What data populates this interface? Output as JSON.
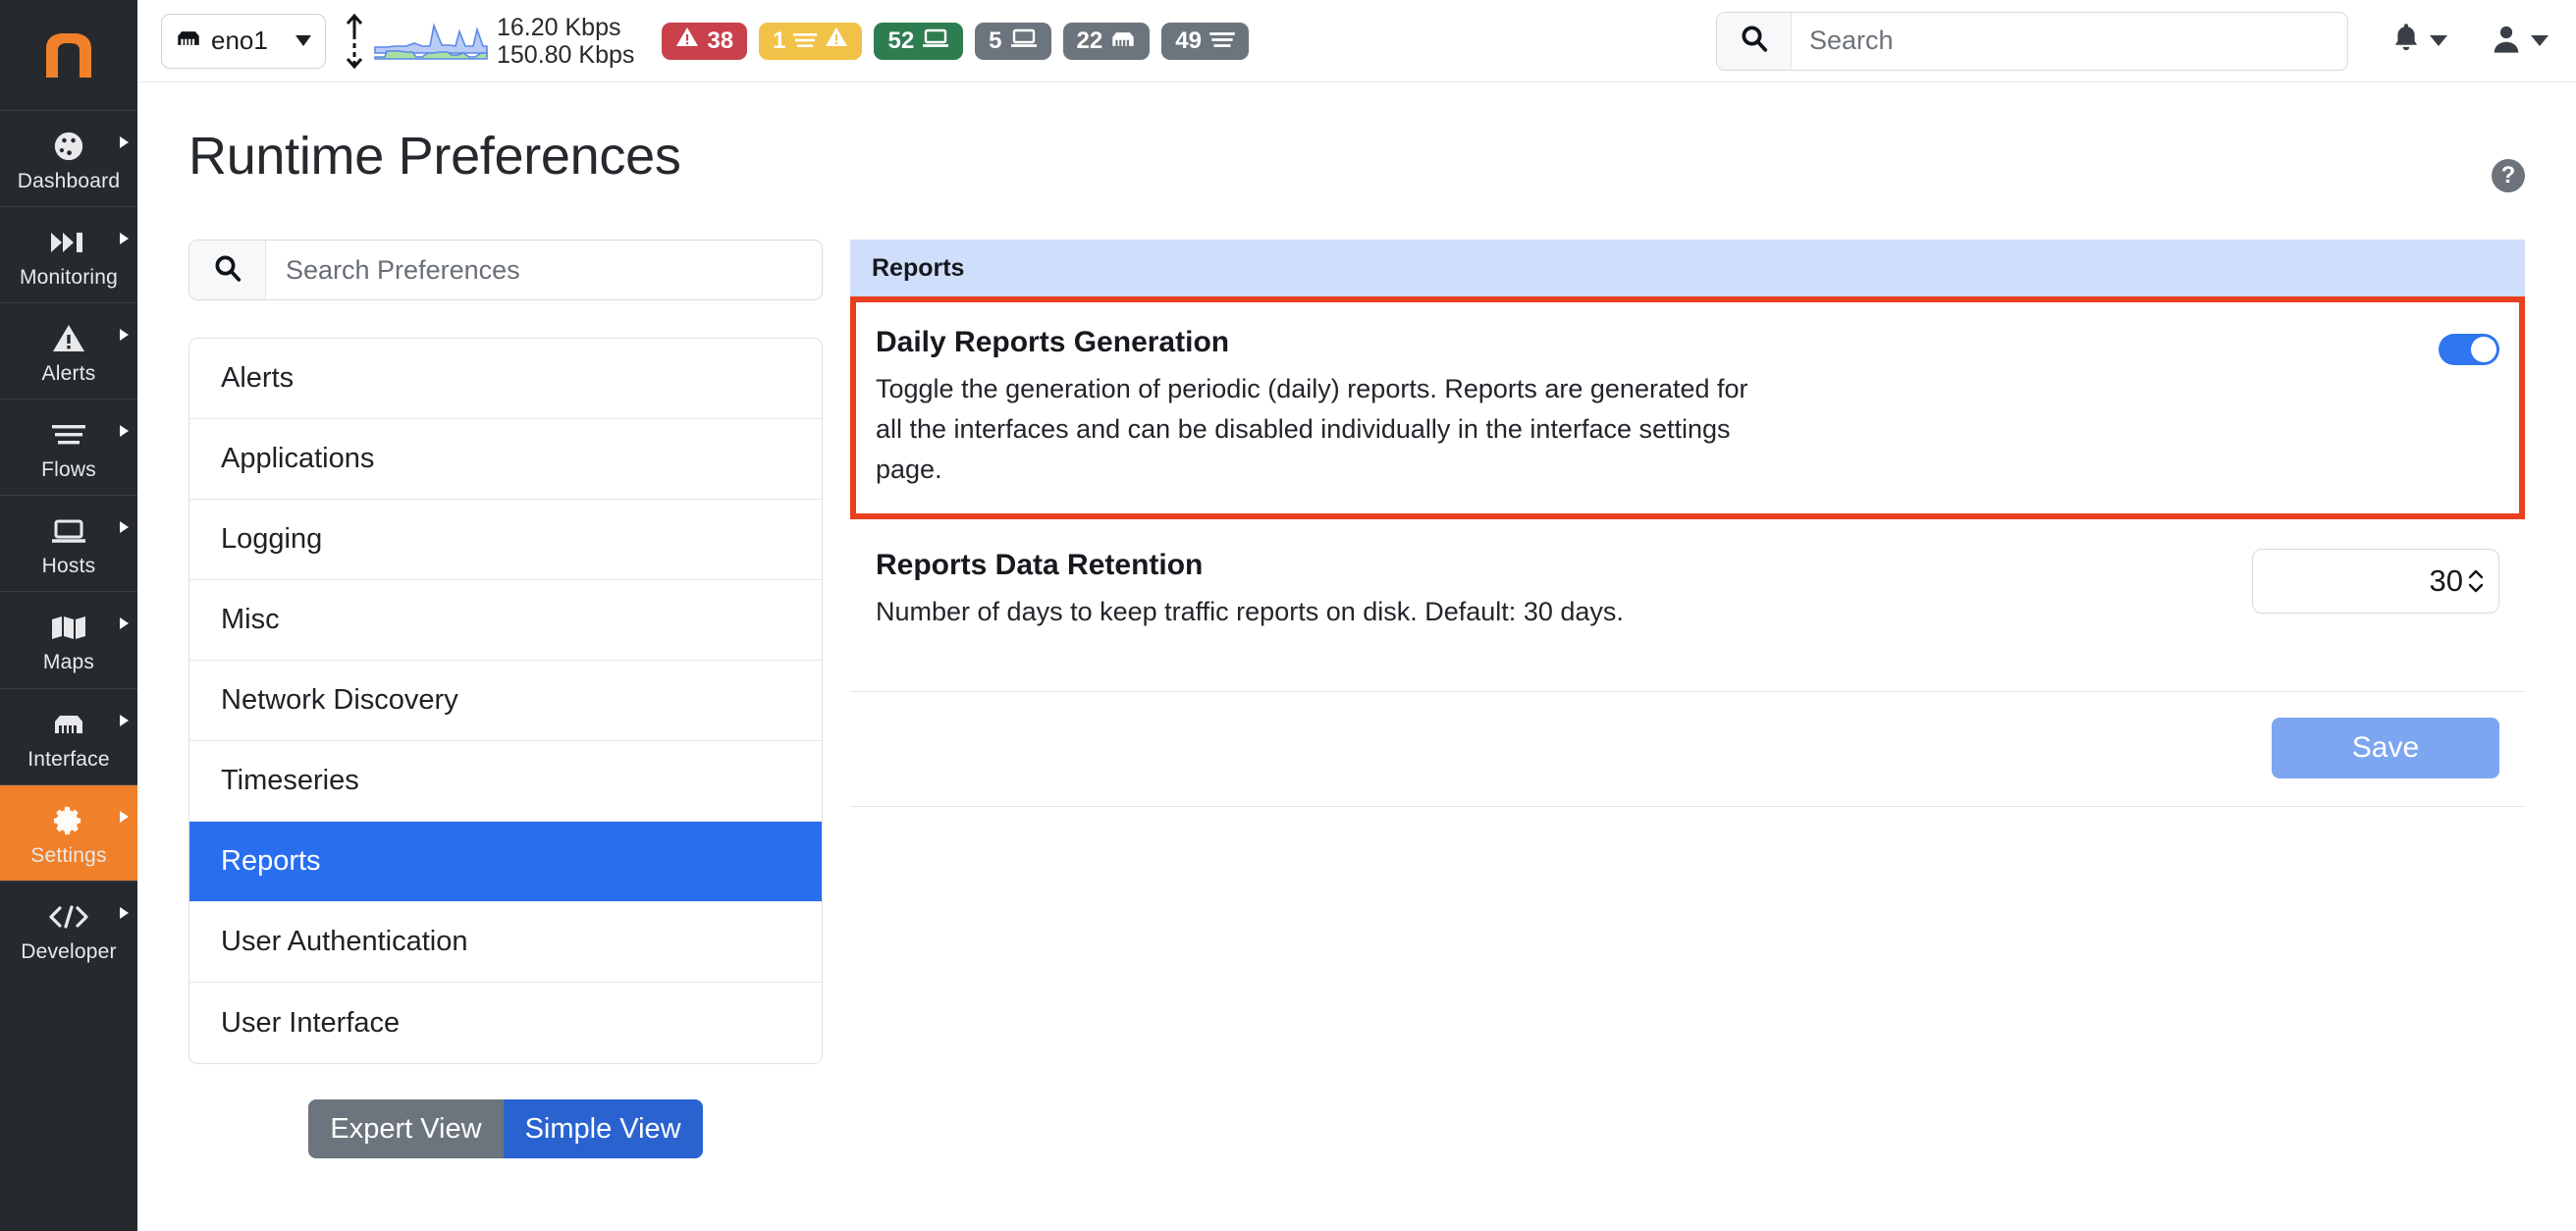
{
  "sidebar": {
    "logo_name": "ntopng-logo",
    "items": [
      {
        "label": "Dashboard",
        "icon": "dashboard-icon",
        "active": false
      },
      {
        "label": "Monitoring",
        "icon": "monitoring-icon",
        "active": false
      },
      {
        "label": "Alerts",
        "icon": "alerts-warning-icon",
        "active": false
      },
      {
        "label": "Flows",
        "icon": "flows-lines-icon",
        "active": false
      },
      {
        "label": "Hosts",
        "icon": "hosts-laptop-icon",
        "active": false
      },
      {
        "label": "Maps",
        "icon": "maps-icon",
        "active": false
      },
      {
        "label": "Interface",
        "icon": "interface-ethernet-icon",
        "active": false
      },
      {
        "label": "Settings",
        "icon": "settings-gear-icon",
        "active": true
      },
      {
        "label": "Developer",
        "icon": "developer-code-icon",
        "active": false
      }
    ]
  },
  "topbar": {
    "interface": {
      "name": "eno1",
      "icon": "ethernet-port-icon"
    },
    "traffic": {
      "up_rate": "16.20 Kbps",
      "down_rate": "150.80 Kbps",
      "sparkline_name": "traffic-sparkline"
    },
    "badges": [
      {
        "value": "38",
        "icon": "warning-triangle-icon",
        "color": "#c9414b",
        "name": "badge-alerts-critical"
      },
      {
        "value": "1",
        "icon": "flow-warning-icon",
        "color": "#f1c248",
        "name": "badge-flow-alerts"
      },
      {
        "value": "52",
        "icon": "laptop-icon",
        "color": "#2e7d51",
        "name": "badge-hosts-active"
      },
      {
        "value": "5",
        "icon": "laptop-icon",
        "color": "#6c757d",
        "name": "badge-hosts-idle"
      },
      {
        "value": "22",
        "icon": "ethernet-port-icon",
        "color": "#6c757d",
        "name": "badge-devices"
      },
      {
        "value": "49",
        "icon": "flows-lines-icon",
        "color": "#6c757d",
        "name": "badge-flows"
      }
    ],
    "search": {
      "placeholder": "Search",
      "value": "",
      "icon": "search-icon"
    },
    "notifications_icon": "bell-icon",
    "user_icon": "user-avatar-icon"
  },
  "page": {
    "title": "Runtime Preferences",
    "help_label": "?"
  },
  "preferences": {
    "search": {
      "placeholder": "Search Preferences",
      "value": "",
      "icon": "search-icon"
    },
    "categories": [
      {
        "label": "Alerts",
        "active": false
      },
      {
        "label": "Applications",
        "active": false
      },
      {
        "label": "Logging",
        "active": false
      },
      {
        "label": "Misc",
        "active": false
      },
      {
        "label": "Network Discovery",
        "active": false
      },
      {
        "label": "Timeseries",
        "active": false
      },
      {
        "label": "Reports",
        "active": true
      },
      {
        "label": "User Authentication",
        "active": false
      },
      {
        "label": "User Interface",
        "active": false
      }
    ],
    "view_toggle": {
      "expert_label": "Expert View",
      "simple_label": "Simple View",
      "selected": "Simple View"
    }
  },
  "panel": {
    "header": "Reports",
    "settings": [
      {
        "title": "Daily Reports Generation",
        "description": "Toggle the generation of periodic (daily) reports. Reports are generated for all the interfaces and can be disabled individually in the interface settings page.",
        "control": "toggle",
        "toggle_state": "on",
        "highlighted": true
      },
      {
        "title": "Reports Data Retention",
        "description": "Number of days to keep traffic reports on disk. Default: 30 days.",
        "control": "number",
        "value": "30",
        "highlighted": false
      }
    ],
    "save_label": "Save"
  },
  "colors": {
    "brand_orange": "#f0802a",
    "accent_blue": "#2a6ef0",
    "highlight_red": "#e8401f",
    "panel_header_blue": "#cfdefa"
  }
}
